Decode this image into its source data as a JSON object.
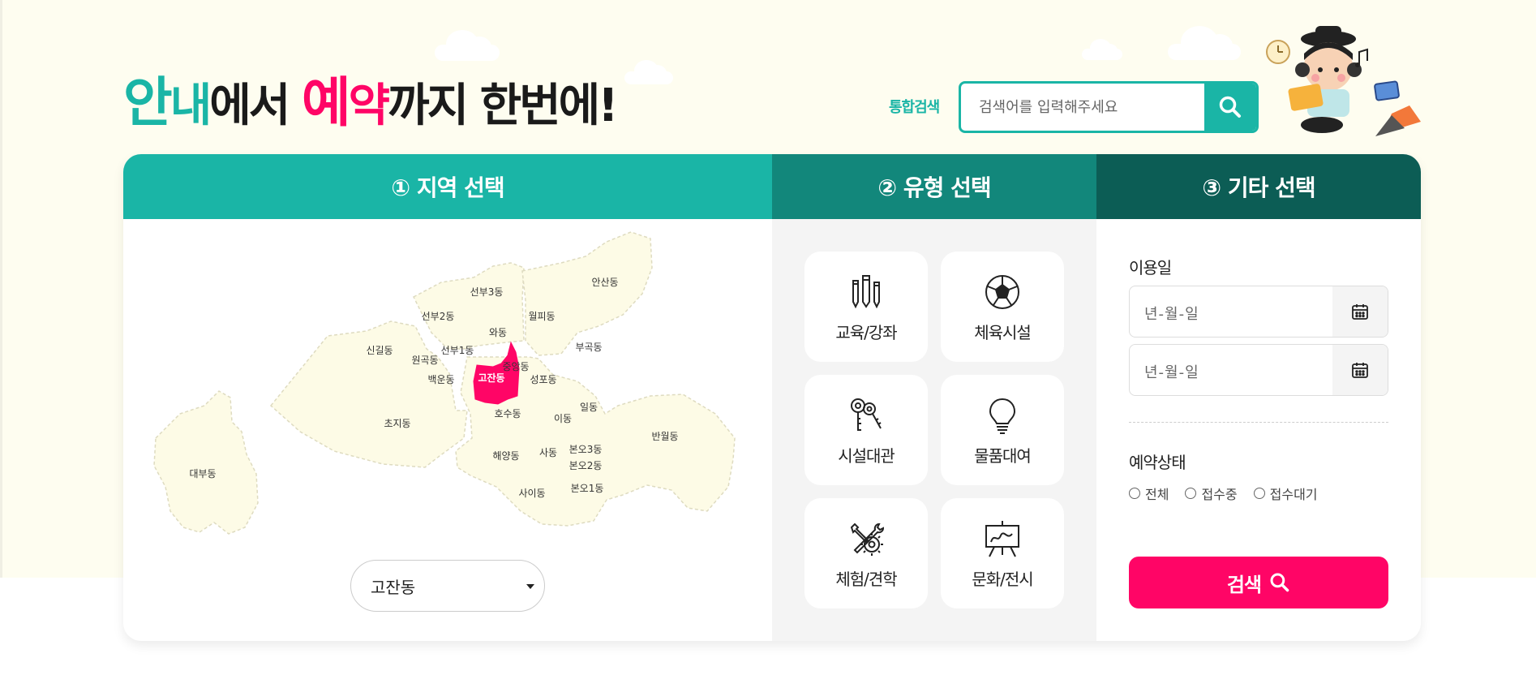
{
  "headline": {
    "part1": "안",
    "part2": "내",
    "part3": "에서 ",
    "part4": "예",
    "part5": "약",
    "part6": "까지 한번에!"
  },
  "search": {
    "label": "통합검색",
    "placeholder": "검색어를 입력해주세요",
    "button_icon": "search-icon"
  },
  "tabs": {
    "region": "① 지역 선택",
    "type": "② 유형 선택",
    "etc": "③ 기타 선택"
  },
  "map": {
    "selected": "고잔동",
    "districts": [
      "선부3동",
      "안산동",
      "선부2동",
      "월피동",
      "와동",
      "신길동",
      "선부1동",
      "부곡동",
      "원곡동",
      "중앙동",
      "고잔동",
      "백운동",
      "성포동",
      "일동",
      "호수동",
      "초지동",
      "이동",
      "반월동",
      "본오3동",
      "사동",
      "해양동",
      "본오2동",
      "대부동",
      "본오1동",
      "사이동"
    ]
  },
  "region_select": {
    "value": "고잔동"
  },
  "types": [
    {
      "label": "교육/강좌",
      "icon": "pencils-icon"
    },
    {
      "label": "체육시설",
      "icon": "soccer-ball-icon"
    },
    {
      "label": "시설대관",
      "icon": "keys-icon"
    },
    {
      "label": "물품대여",
      "icon": "lightbulb-icon"
    },
    {
      "label": "체험/견학",
      "icon": "tools-icon"
    },
    {
      "label": "문화/전시",
      "icon": "easel-icon"
    }
  ],
  "etc": {
    "date_label": "이용일",
    "date_start_placeholder": "년-월-일",
    "date_end_placeholder": "년-월-일",
    "status_label": "예약상태",
    "status_options": [
      "전체",
      "접수중",
      "접수대기"
    ],
    "submit_label": "검색"
  },
  "colors": {
    "teal": "#1ab5a6",
    "teal_dark": "#12877b",
    "teal_darker": "#0c5d55",
    "pink": "#ff0566",
    "map_fill": "#fdfbe6"
  }
}
